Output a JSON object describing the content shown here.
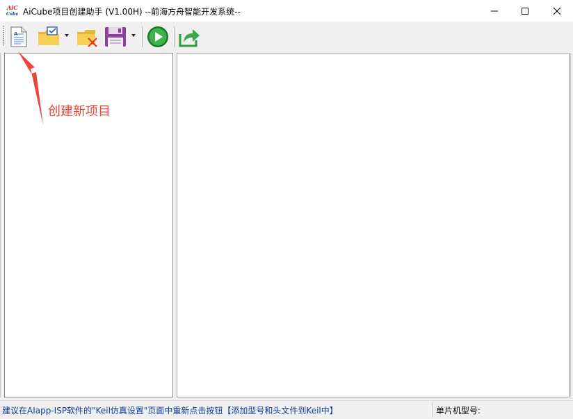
{
  "window": {
    "title": "AiCube项目创建助手 (V1.00H) --前海方舟智能开发系统--",
    "logo_top": "AiC",
    "logo_bottom": "Cube"
  },
  "toolbar": {
    "buttons": [
      {
        "name": "new-project",
        "icon": "new-document-icon"
      },
      {
        "name": "open-project",
        "icon": "folder-check-icon",
        "has_dropdown": true
      },
      {
        "name": "close-project",
        "icon": "folder-delete-icon"
      },
      {
        "name": "save-project",
        "icon": "floppy-disk-icon",
        "has_dropdown": true
      },
      {
        "name": "run",
        "icon": "green-play-icon"
      },
      {
        "name": "export",
        "icon": "share-arrow-icon"
      }
    ]
  },
  "annotation": {
    "label": "创建新项目",
    "color": "#e8453c"
  },
  "statusbar": {
    "message": "建议在AIapp-ISP软件的\"Keil仿真设置\"页面中重新点击按钮【添加型号和头文件到Keil中】",
    "mcu_label": "单片机型号:",
    "message_color": "#0a3c9a"
  }
}
